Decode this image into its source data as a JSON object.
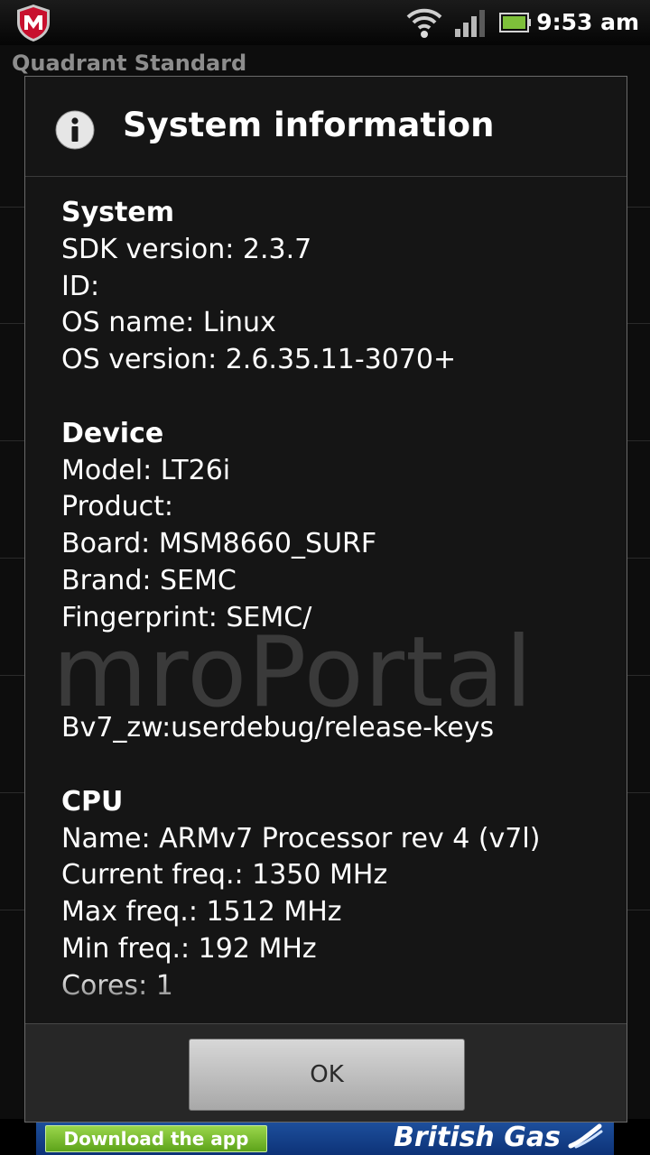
{
  "status_bar": {
    "time": "9:53 am",
    "icons": [
      "mcafee-icon",
      "wifi-icon",
      "signal-icon",
      "battery-icon"
    ]
  },
  "app": {
    "title": "Quadrant Standard"
  },
  "dialog": {
    "title": "System information",
    "icon": "info-icon",
    "watermark": "mroPortal",
    "sections": {
      "system": {
        "heading": "System",
        "sdk_version": "SDK version: 2.3.7",
        "id": "ID:",
        "os_name": "OS name: Linux",
        "os_version": "OS version: 2.6.35.11-3070+"
      },
      "device": {
        "heading": "Device",
        "model": "Model: LT26i",
        "product": "Product:",
        "board": "Board: MSM8660_SURF",
        "brand": "Brand: SEMC",
        "fingerprint": "Fingerprint: SEMC/",
        "fingerprint_cont": "Bv7_zw:userdebug/release-keys"
      },
      "cpu": {
        "heading": "CPU",
        "name": "Name: ARMv7 Processor rev 4 (v7l)",
        "current_freq": "Current freq.: 1350 MHz",
        "max_freq": "Max freq.: 1512 MHz",
        "min_freq": "Min freq.: 192 MHz",
        "cores": "Cores: 1"
      }
    },
    "ok_label": "OK"
  },
  "ad": {
    "download_label": "Download the app",
    "brand": "British Gas",
    "colors": {
      "background": "#1d4f9c",
      "button": "#7cc234"
    }
  }
}
